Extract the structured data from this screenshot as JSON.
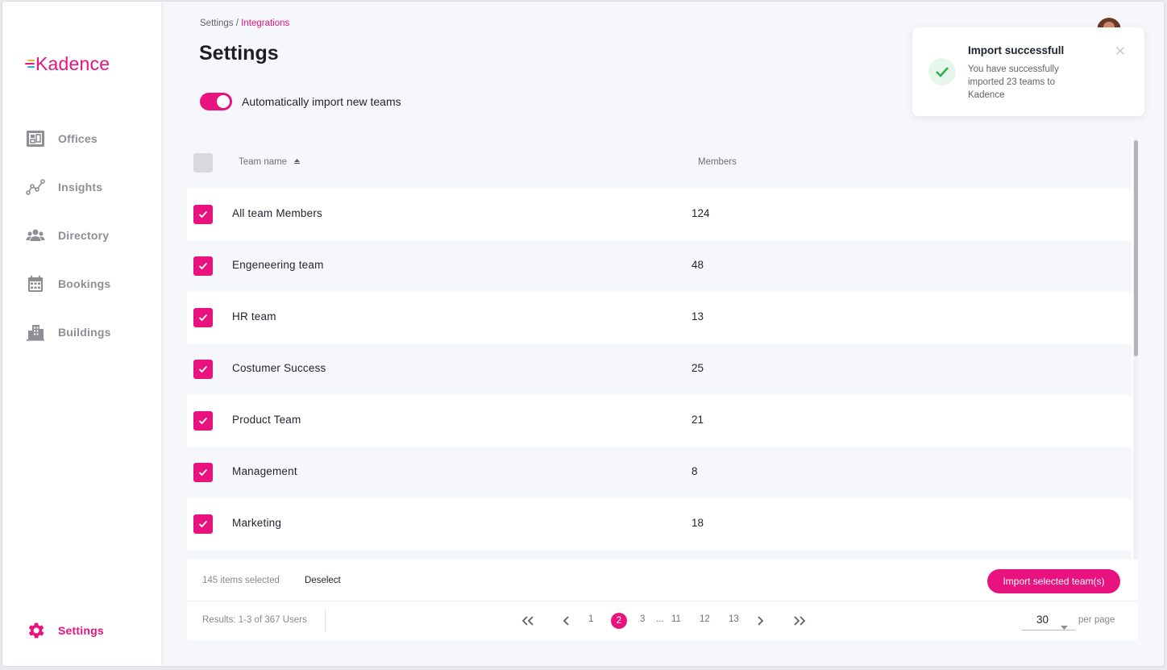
{
  "app": {
    "logo_text": "Kadence",
    "brand_color": "#e8137f"
  },
  "sidebar": {
    "items": [
      {
        "label": "Offices",
        "icon": "office-map-icon"
      },
      {
        "label": "Insights",
        "icon": "insights-chart-icon"
      },
      {
        "label": "Directory",
        "icon": "people-icon"
      },
      {
        "label": "Bookings",
        "icon": "calendar-icon"
      },
      {
        "label": "Buildings",
        "icon": "buildings-icon"
      }
    ],
    "settings": {
      "label": "Settings",
      "icon": "gear-icon",
      "active": true
    }
  },
  "breadcrumb": {
    "root": "Settings",
    "separator": " / ",
    "current": "Integrations"
  },
  "page": {
    "title": "Settings"
  },
  "auto_import": {
    "label": "Automatically import new teams",
    "enabled": true
  },
  "table": {
    "headers": {
      "team_name": "Team name",
      "members": "Members"
    },
    "sort": {
      "column": "team_name",
      "direction": "ascending"
    },
    "rows": [
      {
        "name": "All team Members",
        "members": "124",
        "checked": true
      },
      {
        "name": "Engeneering team",
        "members": "48",
        "checked": true
      },
      {
        "name": "HR team",
        "members": "13",
        "checked": true
      },
      {
        "name": "Costumer Success",
        "members": "25",
        "checked": true
      },
      {
        "name": "Product Team",
        "members": "21",
        "checked": true
      },
      {
        "name": "Management",
        "members": "8",
        "checked": true
      },
      {
        "name": "Marketing",
        "members": "18",
        "checked": true
      }
    ]
  },
  "selection": {
    "count_text": "145 items selected",
    "deselect_label": "Deselect",
    "import_button_label": "Import selected team(s)"
  },
  "pagination": {
    "results_text": "Results: 1-3 of 367 Users",
    "pages": {
      "p1": "1",
      "p2": "2",
      "p3": "3",
      "ellipsis": "...",
      "p11": "11",
      "p12": "12",
      "p13": "13"
    },
    "current_page": "2",
    "per_page_value": "30",
    "per_page_label": "per page"
  },
  "toast": {
    "title": "Import successfull",
    "message": "You have successfully imported 23 teams to Kadence",
    "status_color": "#2fb14d"
  }
}
